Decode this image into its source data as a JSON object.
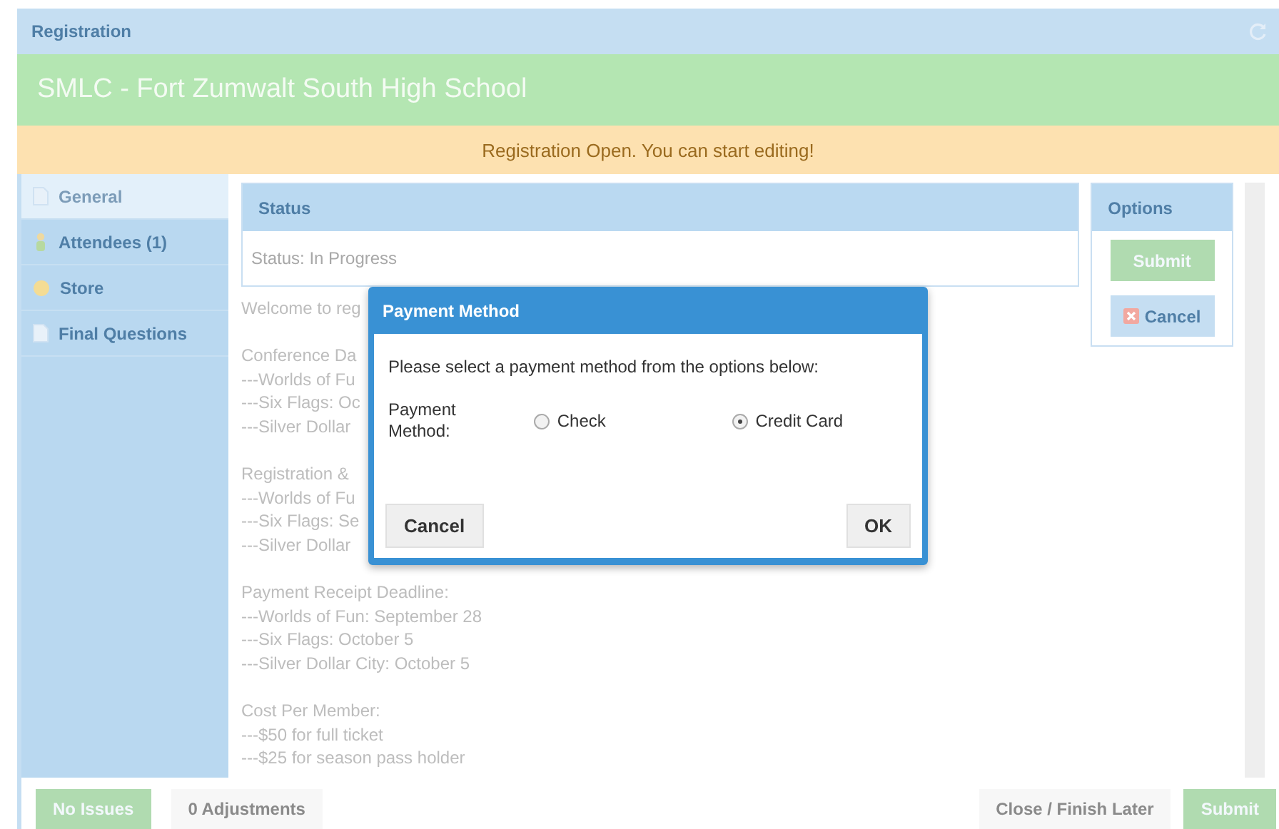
{
  "window": {
    "title": "Registration"
  },
  "header": {
    "title": "SMLC - Fort Zumwalt South High School"
  },
  "banner": {
    "text": "Registration Open. You can start editing!"
  },
  "sidebar": {
    "items": [
      {
        "label": "General",
        "selected": true
      },
      {
        "label": "Attendees (1)",
        "selected": false
      },
      {
        "label": "Store",
        "selected": false
      },
      {
        "label": "Final Questions",
        "selected": false
      }
    ]
  },
  "status_panel": {
    "title": "Status",
    "text": "Status:  In Progress"
  },
  "content": {
    "paragraphs": [
      [
        "Welcome to reg"
      ],
      [
        "Conference Da",
        "---Worlds of Fu",
        "---Six Flags: Oc",
        "---Silver Dollar"
      ],
      [
        "Registration &",
        "---Worlds of Fu",
        "---Six Flags: Se",
        "---Silver Dollar"
      ],
      [
        "Payment Receipt Deadline:",
        "---Worlds of Fun: September 28",
        "---Six Flags: October 5",
        "---Silver Dollar City: October 5"
      ],
      [
        "Cost Per Member:",
        "---$50 for full ticket",
        "---$25 for season pass holder"
      ]
    ]
  },
  "options_panel": {
    "title": "Options",
    "buttons": [
      {
        "label": "Submit",
        "kind": "submit"
      },
      {
        "label": "Cancel",
        "kind": "cancel"
      }
    ]
  },
  "dialog": {
    "title": "Payment Method",
    "prompt": "Please select a payment method from the options below:",
    "field_label": "Payment Method:",
    "options": [
      {
        "label": "Check",
        "selected": false
      },
      {
        "label": "Credit Card",
        "selected": true
      }
    ],
    "cancel": "Cancel",
    "ok": "OK"
  },
  "footer": {
    "left": [
      {
        "label": "No Issues",
        "kind": "success"
      },
      {
        "label": "0 Adjustments",
        "kind": "plain"
      }
    ],
    "right": [
      {
        "label": "Close / Finish Later",
        "kind": "plain"
      },
      {
        "label": "Submit",
        "kind": "success"
      }
    ]
  }
}
